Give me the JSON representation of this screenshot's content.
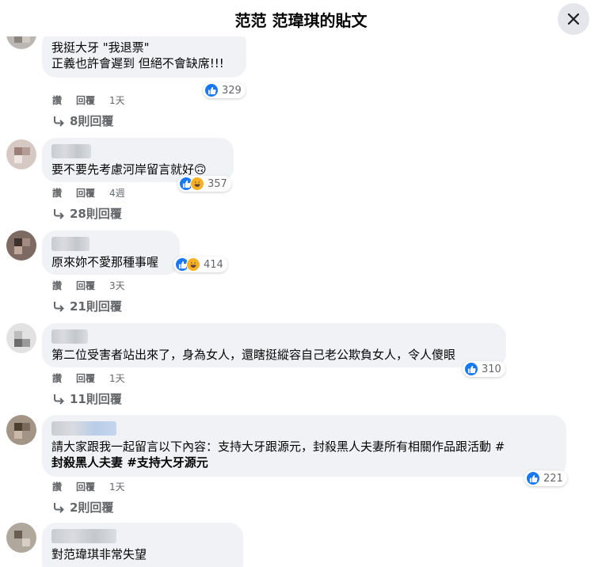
{
  "header": {
    "title": "范范 范瑋琪的貼文",
    "close_icon": "close-icon"
  },
  "colors": {
    "bubble": "#f0f2f5",
    "like": "#1877f2",
    "haha": "#f7b125",
    "meta": "#65676b"
  },
  "comments": [
    {
      "text": "我挺大牙 \"我退票\"\n正義也許會遲到 但絕不會缺席!!!",
      "reactions": [
        "like"
      ],
      "count": "329",
      "actions": {
        "like": "讚",
        "reply": "回覆",
        "time": "1天"
      },
      "replies": "8則回覆"
    },
    {
      "text": "要不要先考慮河岸留言就好🙃",
      "reactions": [
        "like",
        "haha"
      ],
      "count": "357",
      "actions": {
        "like": "讚",
        "reply": "回覆",
        "time": "4週"
      },
      "replies": "28則回覆"
    },
    {
      "text": "原來妳不愛那種事喔",
      "reactions": [
        "like",
        "haha"
      ],
      "count": "414",
      "actions": {
        "like": "讚",
        "reply": "回覆",
        "time": "3天"
      },
      "replies": "21則回覆"
    },
    {
      "text": "第二位受害者站出來了，身為女人，還瞎挺縱容自己老公欺負女人，令人傻眼",
      "reactions": [
        "like"
      ],
      "count": "310",
      "actions": {
        "like": "讚",
        "reply": "回覆",
        "time": "1天"
      },
      "replies": "11則回覆"
    },
    {
      "text_plain": "請大家跟我一起留言以下內容：支持大牙跟源元，封殺黑人夫妻所有相關作品跟活動 #",
      "text_tags": "封殺黑人夫妻 #支持大牙源元",
      "reactions": [
        "like"
      ],
      "count": "221",
      "actions": {
        "like": "讚",
        "reply": "回覆",
        "time": "1天"
      },
      "replies": "2則回覆"
    },
    {
      "text": "對范瑋琪非常失望"
    }
  ]
}
